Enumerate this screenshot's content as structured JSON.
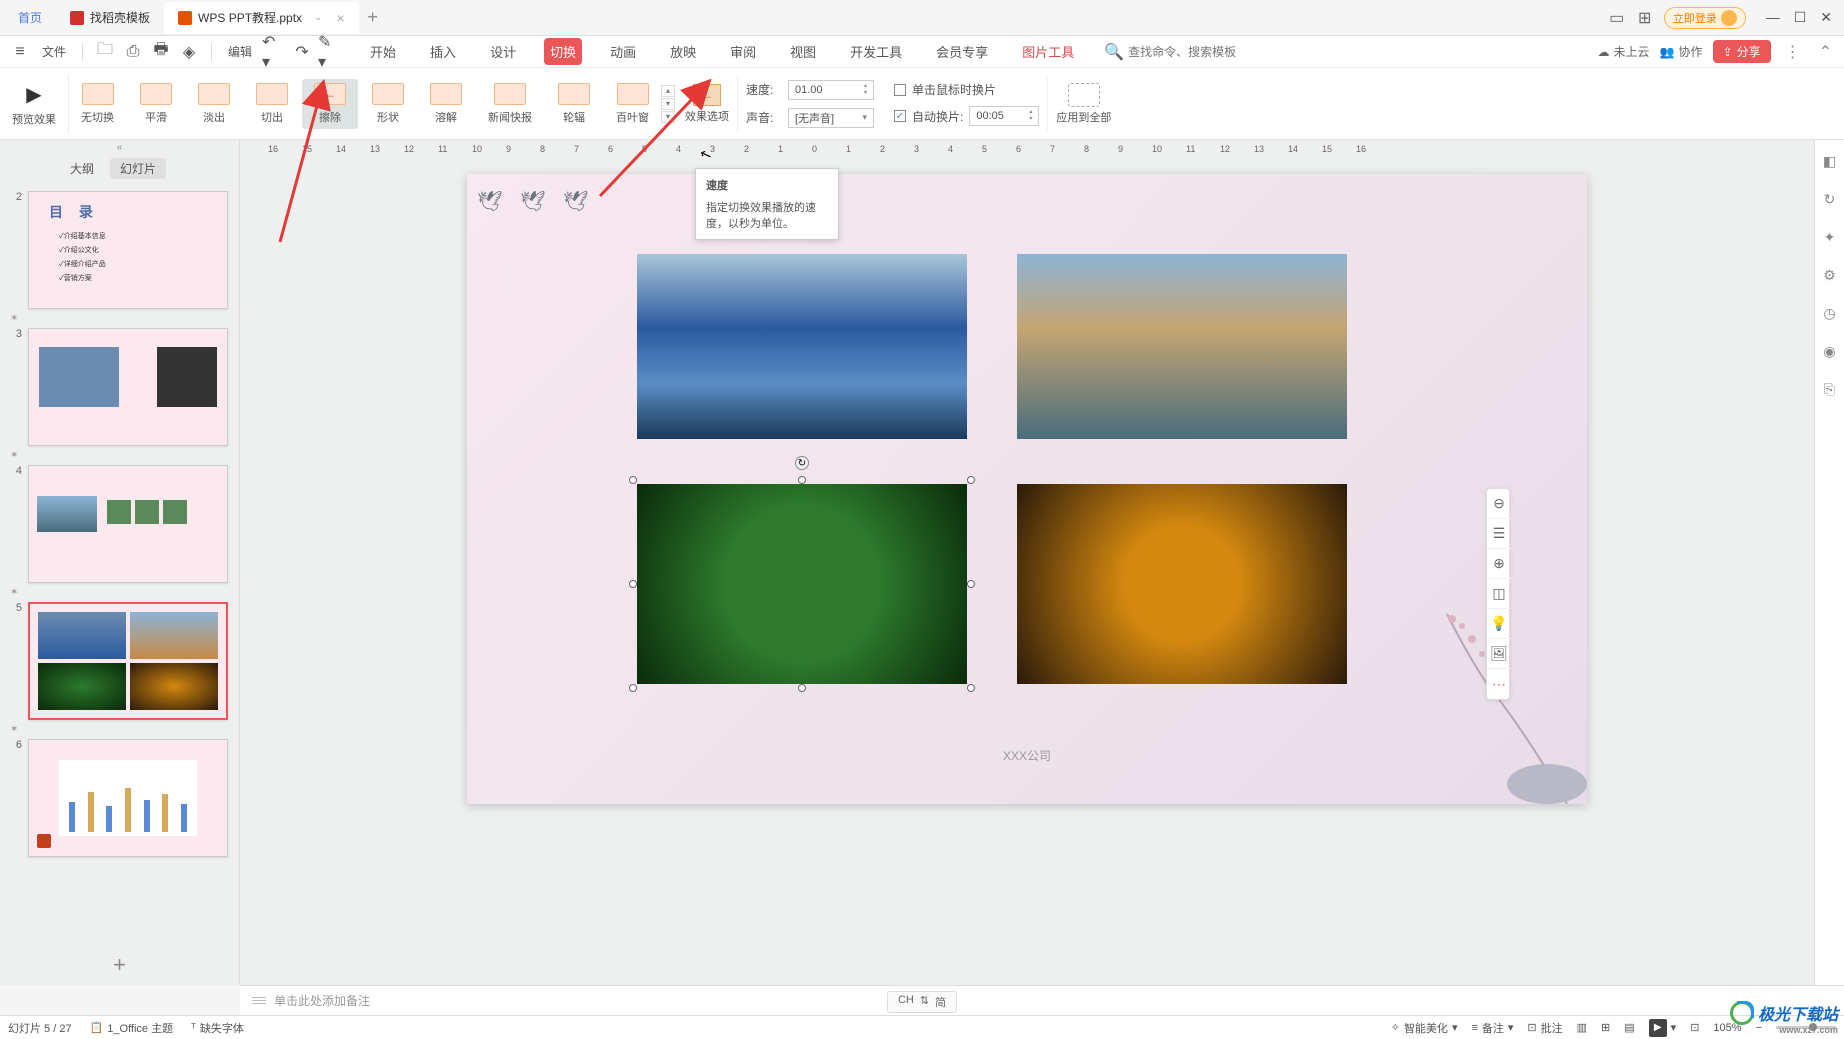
{
  "tabs": {
    "home": "首页",
    "template": "找稻壳模板",
    "file": "WPS PPT教程.pptx"
  },
  "topRight": {
    "login": "立即登录"
  },
  "menuBar": {
    "file": "文件",
    "edit": "编辑",
    "menus": [
      "开始",
      "插入",
      "设计",
      "切换",
      "动画",
      "放映",
      "审阅",
      "视图",
      "开发工具",
      "会员专享",
      "图片工具"
    ],
    "activeMenu": "切换",
    "specialMenu": "图片工具",
    "searchPlaceholder": "查找命令、搜索模板",
    "cloud": "未上云",
    "collab": "协作",
    "share": "分享"
  },
  "ribbon": {
    "preview": "预览效果",
    "transitions": [
      "无切换",
      "平滑",
      "淡出",
      "切出",
      "擦除",
      "形状",
      "溶解",
      "新闻快报",
      "轮辐",
      "百叶窗"
    ],
    "selectedTransition": "擦除",
    "effectOptions": "效果选项",
    "speed": {
      "label": "速度:",
      "value": "01.00"
    },
    "sound": {
      "label": "声音:",
      "value": "[无声音]"
    },
    "onClick": "单击鼠标时换片",
    "autoAdvance": "自动换片:",
    "autoValue": "00:05",
    "applyAll": "应用到全部"
  },
  "tooltip": {
    "title": "速度",
    "body": "指定切换效果播放的速度，以秒为单位。"
  },
  "leftPanel": {
    "outline": "大纲",
    "slides": "幻灯片",
    "slideNums": [
      "2",
      "3",
      "4",
      "5",
      "6"
    ],
    "activeSlide": "5",
    "slide2": {
      "title": "目 录",
      "items": [
        "✓介绍基本信息",
        "✓介绍公文化",
        "✓详细介绍产品",
        "✓营销方案"
      ]
    }
  },
  "canvas": {
    "company": "XXX公司"
  },
  "notes": {
    "placeholder": "单击此处添加备注"
  },
  "statusBar": {
    "slideInfo": "幻灯片 5 / 27",
    "theme": "1_Office 主题",
    "missingFont": "缺失字体",
    "beautify": "智能美化",
    "notes": "备注",
    "comment": "批注",
    "zoom": "105%"
  },
  "ime": {
    "ch": "CH",
    "lang": "简"
  },
  "ruler": {
    "marks": [
      "16",
      "15",
      "14",
      "13",
      "12",
      "11",
      "10",
      "9",
      "8",
      "7",
      "6",
      "5",
      "4",
      "3",
      "2",
      "1",
      "0",
      "1",
      "2",
      "3",
      "4",
      "5",
      "6",
      "7",
      "8",
      "9",
      "10",
      "11",
      "12",
      "13",
      "14",
      "15",
      "16"
    ]
  },
  "watermark": "极光下载站"
}
